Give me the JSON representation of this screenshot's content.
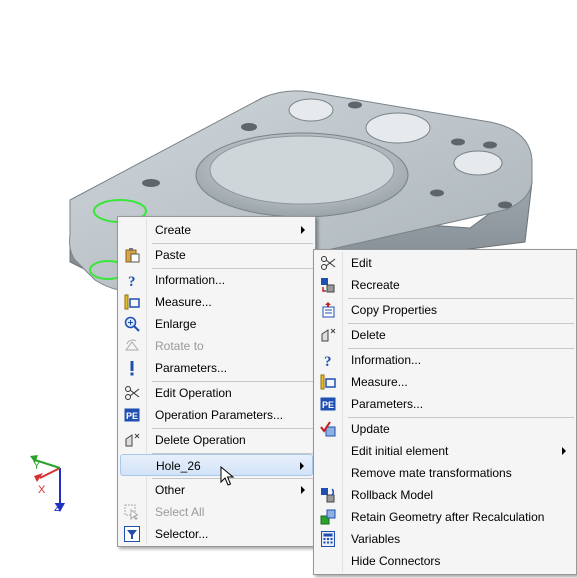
{
  "context_menu": {
    "items": [
      {
        "label": "Create",
        "icon": "blank",
        "submenu": true,
        "enabled": true
      },
      {
        "label": "Paste",
        "icon": "paste-icon",
        "submenu": false,
        "enabled": true
      },
      {
        "label": "Information...",
        "icon": "help-icon",
        "submenu": false,
        "enabled": true
      },
      {
        "label": "Measure...",
        "icon": "measure-icon",
        "submenu": false,
        "enabled": true
      },
      {
        "label": "Enlarge",
        "icon": "zoom-icon",
        "submenu": false,
        "enabled": true
      },
      {
        "label": "Rotate to",
        "icon": "rotate-icon",
        "submenu": false,
        "enabled": false
      },
      {
        "label": "Parameters...",
        "icon": "exclamation-icon",
        "submenu": false,
        "enabled": true
      },
      {
        "label": "Edit Operation",
        "icon": "edit-icon",
        "submenu": false,
        "enabled": true
      },
      {
        "label": "Operation Parameters...",
        "icon": "params-icon",
        "submenu": false,
        "enabled": true
      },
      {
        "label": "Delete Operation",
        "icon": "delete-icon",
        "submenu": false,
        "enabled": true
      },
      {
        "label": "Hole_26",
        "icon": "blank",
        "submenu": true,
        "enabled": true,
        "highlighted": true
      },
      {
        "label": "Other",
        "icon": "blank",
        "submenu": true,
        "enabled": true
      },
      {
        "label": "Select All",
        "icon": "select-all-icon",
        "submenu": false,
        "enabled": false
      },
      {
        "label": "Selector...",
        "icon": "filter-icon",
        "submenu": false,
        "enabled": true
      }
    ]
  },
  "submenu": {
    "items": [
      {
        "label": "Edit",
        "icon": "edit-icon",
        "submenu": false
      },
      {
        "label": "Recreate",
        "icon": "recreate-icon",
        "submenu": false
      },
      {
        "label": "Copy Properties",
        "icon": "copy-properties-icon",
        "submenu": false
      },
      {
        "label": "Delete",
        "icon": "delete-icon",
        "submenu": false
      },
      {
        "label": "Information...",
        "icon": "help-icon",
        "submenu": false
      },
      {
        "label": "Measure...",
        "icon": "measure-icon",
        "submenu": false
      },
      {
        "label": "Parameters...",
        "icon": "params-icon",
        "submenu": false
      },
      {
        "label": "Update",
        "icon": "update-icon",
        "submenu": false
      },
      {
        "label": "Edit initial element",
        "icon": "blank",
        "submenu": true
      },
      {
        "label": "Remove mate transformations",
        "icon": "blank",
        "submenu": false
      },
      {
        "label": "Rollback Model",
        "icon": "rollback-icon",
        "submenu": false
      },
      {
        "label": "Retain Geometry after Recalculation",
        "icon": "retain-geometry-icon",
        "submenu": false
      },
      {
        "label": "Variables",
        "icon": "variables-icon",
        "submenu": false
      },
      {
        "label": "Hide Connectors",
        "icon": "blank",
        "submenu": false
      }
    ]
  },
  "axes": {
    "x": "X",
    "y": "Y",
    "z": "Z"
  },
  "colors": {
    "part_fill": "#b9c2c8",
    "hole_highlight": "#39e639",
    "axis_x": "#d63030",
    "axis_y": "#2ca02c",
    "axis_z": "#2030c0"
  }
}
